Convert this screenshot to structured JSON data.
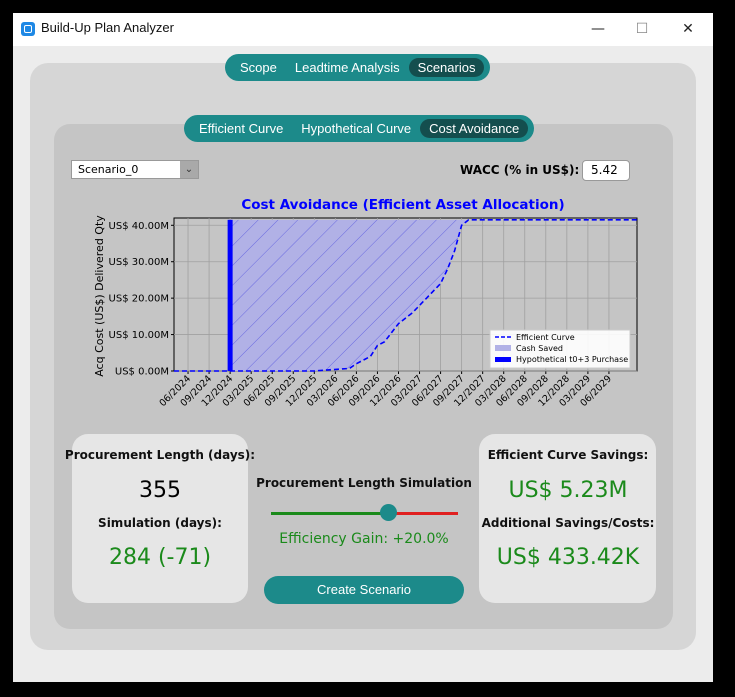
{
  "window": {
    "title": "Build-Up Plan Analyzer",
    "minimize": "—",
    "maximize": "☐",
    "close": "✕"
  },
  "main_tabs": [
    {
      "label": "Scope",
      "active": false
    },
    {
      "label": "Leadtime Analysis",
      "active": false
    },
    {
      "label": "Scenarios",
      "active": true
    }
  ],
  "sub_tabs": [
    {
      "label": "Efficient Curve",
      "active": false
    },
    {
      "label": "Hypothetical Curve",
      "active": false
    },
    {
      "label": "Cost Avoidance",
      "active": true
    }
  ],
  "scenario_select": {
    "value": "Scenario_0",
    "arrow": "⌄"
  },
  "wacc": {
    "label": "WACC (% in US$):",
    "value": "5.42"
  },
  "chart_data": {
    "type": "area",
    "title": "Cost Avoidance (Efficient Asset Allocation)",
    "ylabel": "Acq Cost (US$) Delivered Qty",
    "xlabel": "",
    "x_ticks": [
      "06/2024",
      "09/2024",
      "12/2024",
      "03/2025",
      "06/2025",
      "09/2025",
      "12/2025",
      "03/2026",
      "06/2026",
      "09/2026",
      "12/2026",
      "03/2027",
      "06/2027",
      "09/2027",
      "12/2027",
      "03/2028",
      "06/2028",
      "09/2028",
      "12/2028",
      "03/2029",
      "06/2029"
    ],
    "y_ticks": [
      "US$ 0.00M",
      "US$ 10.00M",
      "US$ 20.00M",
      "US$ 30.00M",
      "US$ 40.00M"
    ],
    "ylim": [
      0,
      42
    ],
    "xlim": [
      "2024-04",
      "2029-10"
    ],
    "grid": true,
    "legend_position": "lower-right",
    "legend": [
      {
        "label": "Efficient Curve",
        "style": "dashed-line"
      },
      {
        "label": "Cash Saved",
        "style": "hatched-fill"
      },
      {
        "label": "Hypothetical t0+3 Purchase",
        "style": "solid-bar"
      }
    ],
    "efficient_curve": [
      [
        "2024-04",
        0
      ],
      [
        "2025-12",
        0
      ],
      [
        "2026-02",
        0.3
      ],
      [
        "2026-05",
        0.7
      ],
      [
        "2026-06",
        2
      ],
      [
        "2026-08",
        4
      ],
      [
        "2026-09",
        7
      ],
      [
        "2026-10",
        8
      ],
      [
        "2026-12",
        13
      ],
      [
        "2027-02",
        16
      ],
      [
        "2027-04",
        20
      ],
      [
        "2027-06",
        24
      ],
      [
        "2027-07",
        28
      ],
      [
        "2027-08",
        33
      ],
      [
        "2027-09",
        40
      ],
      [
        "2027-10",
        41.5
      ],
      [
        "2029-10",
        41.5
      ]
    ],
    "hypothetical_purchase": {
      "x": "2024-12",
      "value": 41.5
    },
    "colors": {
      "efficient": "#0000ff",
      "fill": "#b1b1e6",
      "purchase": "#0000ff",
      "title": "#0000ff",
      "plot_bg": "#c5c5c5"
    }
  },
  "left_card": {
    "procurement_label": "Procurement Length (days):",
    "procurement_value": "355",
    "simulation_label": "Simulation (days):",
    "simulation_value": "284 (-71)"
  },
  "center": {
    "slider_label": "Procurement Length Simulation",
    "slider_fraction": 0.68,
    "gain_text": "Efficiency Gain: +20.0%",
    "button_label": "Create Scenario"
  },
  "right_card": {
    "savings_label": "Efficient Curve Savings:",
    "savings_value": "US$ 5.23M",
    "additional_label": "Additional Savings/Costs:",
    "additional_value": "US$ 433.42K"
  },
  "colors": {
    "accent": "#1c8a8a",
    "active_tab": "#144e4e",
    "green_text": "#1b8a1b",
    "slider_red": "#e02020",
    "slider_green": "#1a8a1a"
  }
}
